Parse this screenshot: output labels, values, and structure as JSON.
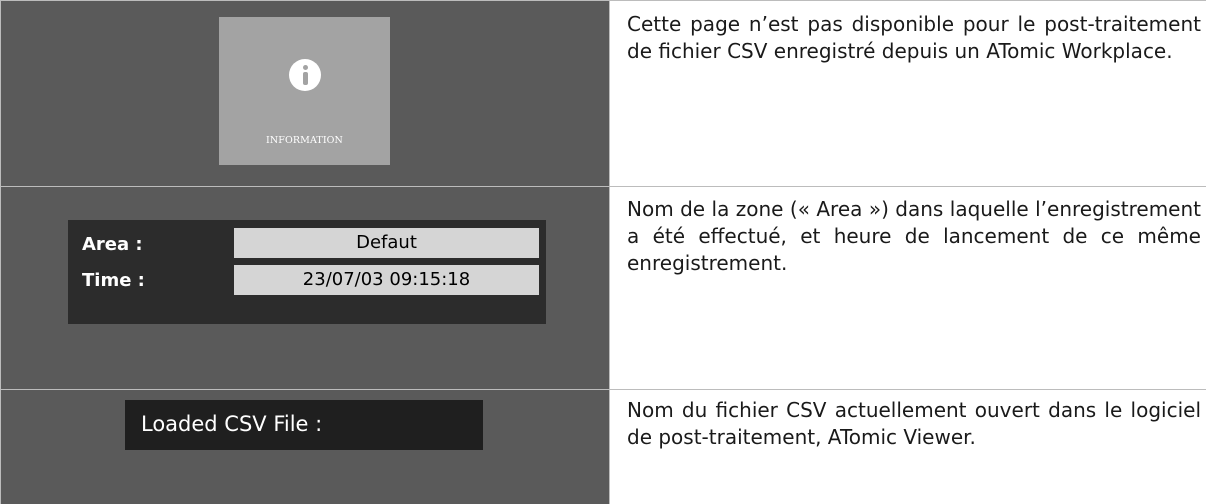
{
  "rows": [
    {
      "image": {
        "label": "INFORMATION",
        "icon": "info-icon"
      },
      "description": "Cette page n’est pas disponible pour le post-traitement de fichier CSV enregistré depuis un ATomic Workplace."
    },
    {
      "image": {
        "area_label": "Area :",
        "area_value": "Defaut",
        "time_label": "Time :",
        "time_value": "23/07/03 09:15:18"
      },
      "description": "Nom de la zone (« Area ») dans laquelle l’enregistrement a été effectué, et heure de lancement de ce même enregistrement."
    },
    {
      "image": {
        "label": "Loaded CSV File :"
      },
      "description": "Nom du fichier CSV actuellement ouvert dans le logiciel de post-traitement, ATomic Viewer."
    }
  ],
  "colors": {
    "image_cell_bg": "#5a5a5a",
    "info_box_bg": "#a3a3a3",
    "panel_bg": "#2c2c2c",
    "field_bg": "#d5d5d5",
    "csv_bar_bg": "#1f1f1f",
    "border": "#bcbcbc"
  }
}
